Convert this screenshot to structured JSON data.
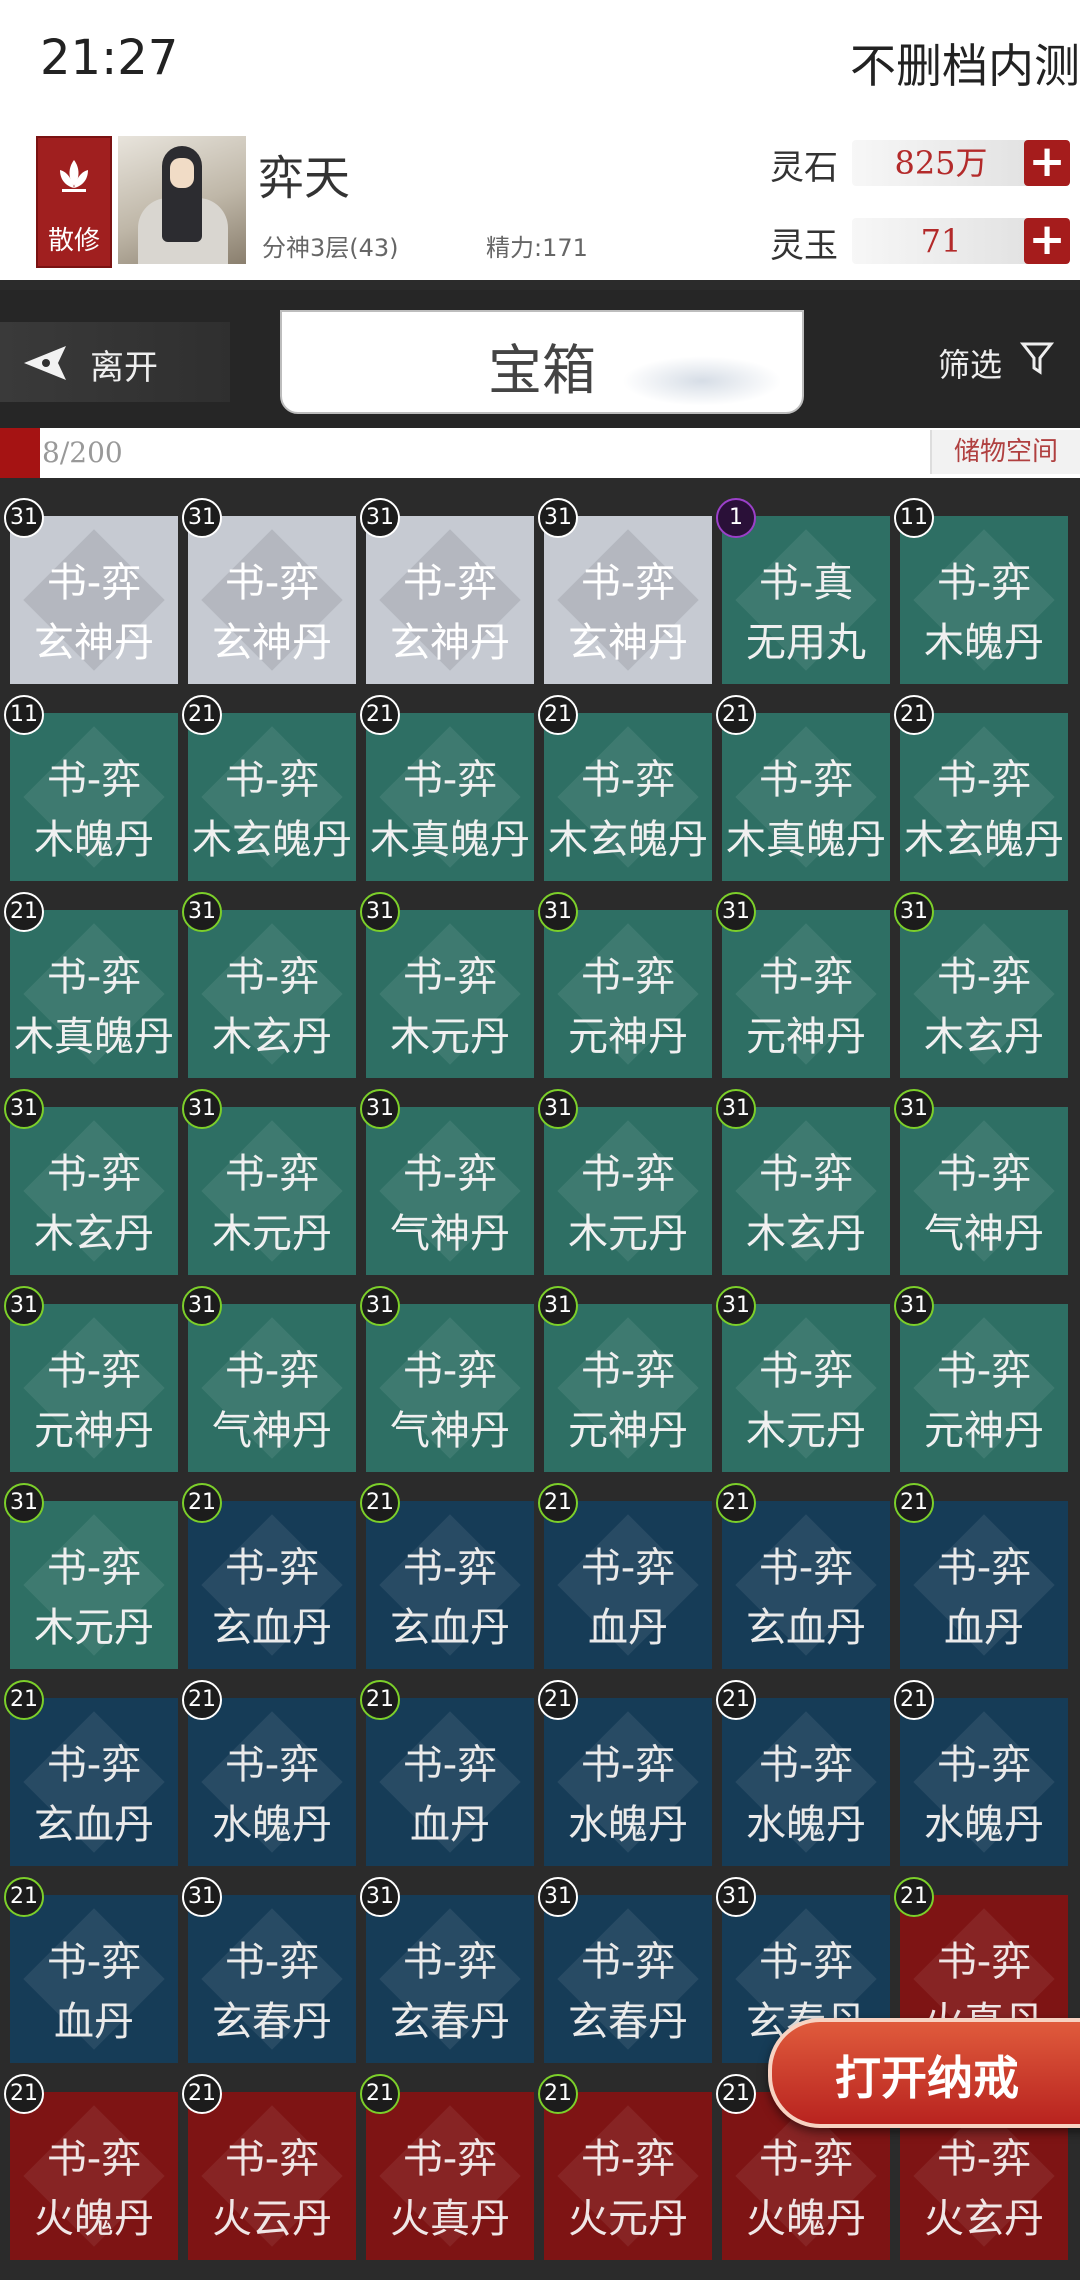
{
  "status_bar": {
    "time": "21:27",
    "right_text": "不删档内测"
  },
  "player": {
    "sect": "散修",
    "name": "弈天",
    "level": "分神3层(43)",
    "energy": "精力:171",
    "currency": [
      {
        "label": "灵石",
        "value": "825万"
      },
      {
        "label": "灵玉",
        "value": "71"
      }
    ]
  },
  "nav": {
    "leave_label": "离开",
    "title": "宝箱",
    "filter_label": "筛选"
  },
  "capacity": {
    "text": "8/200",
    "storage_label": "储物空间"
  },
  "items": [
    {
      "badge": "31",
      "ring": "white",
      "color": "gray",
      "line1": "书-弈",
      "line2": "玄神丹"
    },
    {
      "badge": "31",
      "ring": "white",
      "color": "gray",
      "line1": "书-弈",
      "line2": "玄神丹"
    },
    {
      "badge": "31",
      "ring": "white",
      "color": "gray",
      "line1": "书-弈",
      "line2": "玄神丹"
    },
    {
      "badge": "31",
      "ring": "white",
      "color": "gray",
      "line1": "书-弈",
      "line2": "玄神丹"
    },
    {
      "badge": "1",
      "ring": "purple",
      "color": "green",
      "line1": "书-真",
      "line2": "无用丸"
    },
    {
      "badge": "11",
      "ring": "white",
      "color": "green",
      "line1": "书-弈",
      "line2": "木魄丹"
    },
    {
      "badge": "11",
      "ring": "white",
      "color": "green",
      "line1": "书-弈",
      "line2": "木魄丹"
    },
    {
      "badge": "21",
      "ring": "white",
      "color": "green",
      "line1": "书-弈",
      "line2": "木玄魄丹"
    },
    {
      "badge": "21",
      "ring": "white",
      "color": "green",
      "line1": "书-弈",
      "line2": "木真魄丹"
    },
    {
      "badge": "21",
      "ring": "white",
      "color": "green",
      "line1": "书-弈",
      "line2": "木玄魄丹"
    },
    {
      "badge": "21",
      "ring": "white",
      "color": "green",
      "line1": "书-弈",
      "line2": "木真魄丹"
    },
    {
      "badge": "21",
      "ring": "white",
      "color": "green",
      "line1": "书-弈",
      "line2": "木玄魄丹"
    },
    {
      "badge": "21",
      "ring": "white",
      "color": "green",
      "line1": "书-弈",
      "line2": "木真魄丹"
    },
    {
      "badge": "31",
      "ring": "green",
      "color": "green",
      "line1": "书-弈",
      "line2": "木玄丹"
    },
    {
      "badge": "31",
      "ring": "green",
      "color": "green",
      "line1": "书-弈",
      "line2": "木元丹"
    },
    {
      "badge": "31",
      "ring": "green",
      "color": "green",
      "line1": "书-弈",
      "line2": "元神丹"
    },
    {
      "badge": "31",
      "ring": "green",
      "color": "green",
      "line1": "书-弈",
      "line2": "元神丹"
    },
    {
      "badge": "31",
      "ring": "green",
      "color": "green",
      "line1": "书-弈",
      "line2": "木玄丹"
    },
    {
      "badge": "31",
      "ring": "green",
      "color": "green",
      "line1": "书-弈",
      "line2": "木玄丹"
    },
    {
      "badge": "31",
      "ring": "green",
      "color": "green",
      "line1": "书-弈",
      "line2": "木元丹"
    },
    {
      "badge": "31",
      "ring": "green",
      "color": "green",
      "line1": "书-弈",
      "line2": "气神丹"
    },
    {
      "badge": "31",
      "ring": "green",
      "color": "green",
      "line1": "书-弈",
      "line2": "木元丹"
    },
    {
      "badge": "31",
      "ring": "green",
      "color": "green",
      "line1": "书-弈",
      "line2": "木玄丹"
    },
    {
      "badge": "31",
      "ring": "green",
      "color": "green",
      "line1": "书-弈",
      "line2": "气神丹"
    },
    {
      "badge": "31",
      "ring": "green",
      "color": "green",
      "line1": "书-弈",
      "line2": "元神丹"
    },
    {
      "badge": "31",
      "ring": "green",
      "color": "green",
      "line1": "书-弈",
      "line2": "气神丹"
    },
    {
      "badge": "31",
      "ring": "green",
      "color": "green",
      "line1": "书-弈",
      "line2": "气神丹"
    },
    {
      "badge": "31",
      "ring": "green",
      "color": "green",
      "line1": "书-弈",
      "line2": "元神丹"
    },
    {
      "badge": "31",
      "ring": "green",
      "color": "green",
      "line1": "书-弈",
      "line2": "木元丹"
    },
    {
      "badge": "31",
      "ring": "green",
      "color": "green",
      "line1": "书-弈",
      "line2": "元神丹"
    },
    {
      "badge": "31",
      "ring": "green",
      "color": "green",
      "line1": "书-弈",
      "line2": "木元丹"
    },
    {
      "badge": "21",
      "ring": "green",
      "color": "blue",
      "line1": "书-弈",
      "line2": "玄血丹"
    },
    {
      "badge": "21",
      "ring": "green",
      "color": "blue",
      "line1": "书-弈",
      "line2": "玄血丹"
    },
    {
      "badge": "21",
      "ring": "green",
      "color": "blue",
      "line1": "书-弈",
      "line2": "血丹"
    },
    {
      "badge": "21",
      "ring": "green",
      "color": "blue",
      "line1": "书-弈",
      "line2": "玄血丹"
    },
    {
      "badge": "21",
      "ring": "green",
      "color": "blue",
      "line1": "书-弈",
      "line2": "血丹"
    },
    {
      "badge": "21",
      "ring": "green",
      "color": "blue",
      "line1": "书-弈",
      "line2": "玄血丹"
    },
    {
      "badge": "21",
      "ring": "white",
      "color": "blue",
      "line1": "书-弈",
      "line2": "水魄丹"
    },
    {
      "badge": "21",
      "ring": "green",
      "color": "blue",
      "line1": "书-弈",
      "line2": "血丹"
    },
    {
      "badge": "21",
      "ring": "white",
      "color": "blue",
      "line1": "书-弈",
      "line2": "水魄丹"
    },
    {
      "badge": "21",
      "ring": "white",
      "color": "blue",
      "line1": "书-弈",
      "line2": "水魄丹"
    },
    {
      "badge": "21",
      "ring": "white",
      "color": "blue",
      "line1": "书-弈",
      "line2": "水魄丹"
    },
    {
      "badge": "21",
      "ring": "green",
      "color": "blue",
      "line1": "书-弈",
      "line2": "血丹"
    },
    {
      "badge": "31",
      "ring": "white",
      "color": "blue",
      "line1": "书-弈",
      "line2": "玄春丹"
    },
    {
      "badge": "31",
      "ring": "white",
      "color": "blue",
      "line1": "书-弈",
      "line2": "玄春丹"
    },
    {
      "badge": "31",
      "ring": "white",
      "color": "blue",
      "line1": "书-弈",
      "line2": "玄春丹"
    },
    {
      "badge": "31",
      "ring": "white",
      "color": "blue",
      "line1": "书-弈",
      "line2": "玄春丹"
    },
    {
      "badge": "21",
      "ring": "green",
      "color": "red",
      "line1": "书-弈",
      "line2": "火真丹"
    },
    {
      "badge": "21",
      "ring": "white",
      "color": "red",
      "line1": "书-弈",
      "line2": "火魄丹"
    },
    {
      "badge": "21",
      "ring": "white",
      "color": "red",
      "line1": "书-弈",
      "line2": "火云丹"
    },
    {
      "badge": "21",
      "ring": "green",
      "color": "red",
      "line1": "书-弈",
      "line2": "火真丹"
    },
    {
      "badge": "21",
      "ring": "green",
      "color": "red",
      "line1": "书-弈",
      "line2": "火元丹"
    },
    {
      "badge": "21",
      "ring": "white",
      "color": "red",
      "line1": "书-弈",
      "line2": "火魄丹"
    },
    {
      "badge": "",
      "ring": "white",
      "color": "red",
      "line1": "书-弈",
      "line2": "火玄丹"
    }
  ],
  "open_ring_button": "打开纳戒",
  "colors": {
    "accent_red": "#a51c1c",
    "cell_gray": "#c6cad2",
    "cell_green": "#2e6f64",
    "cell_blue": "#163c57",
    "cell_red": "#7e1414"
  }
}
